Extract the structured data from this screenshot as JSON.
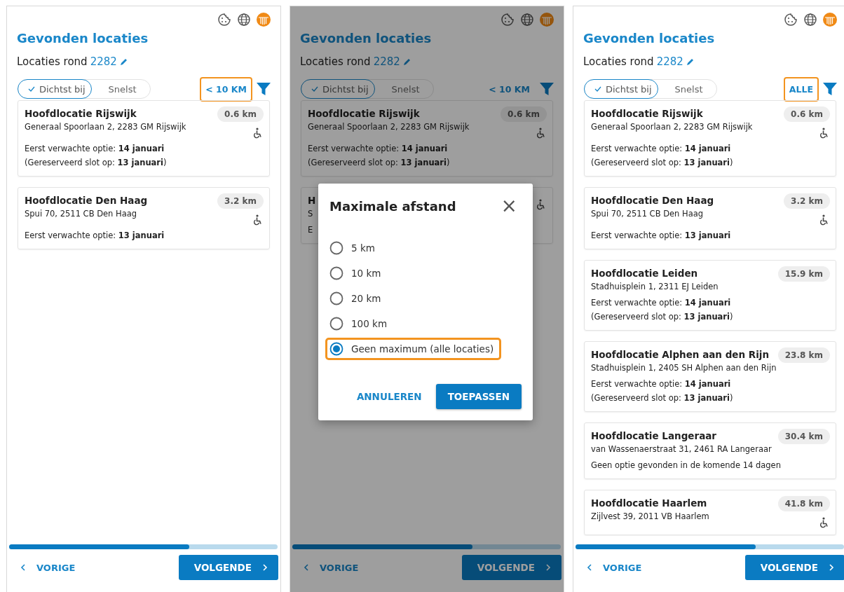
{
  "panels": [
    {
      "title": "Gevonden locaties",
      "search_area": {
        "label": "Locaties rond",
        "postcode": "2282"
      },
      "sort_options": [
        {
          "label": "Dichtst bij",
          "selected": true
        },
        {
          "label": "Snelst",
          "selected": false
        }
      ],
      "distance_filter": {
        "label": "< 10 KM",
        "highlighted": true
      },
      "locations": [
        {
          "name": "Hoofdlocatie Rijswijk",
          "address": "Generaal Spoorlaan 2, 2283 GM Rijswijk",
          "distance": "0.6 km",
          "accessible": true,
          "details": [
            "Eerst verwachte optie: **14 januari**",
            "(Gereserveerd slot op: **13 januari**)"
          ]
        },
        {
          "name": "Hoofdlocatie Den Haag",
          "address": "Spui 70, 2511 CB Den Haag",
          "distance": "3.2 km",
          "accessible": true,
          "details": [
            "Eerst verwachte optie: **13 januari**"
          ]
        }
      ],
      "progress": {
        "level": 0.67
      },
      "navigation": {
        "back": "VORIGE",
        "next": "VOLGENDE"
      }
    },
    {
      "title": "Gevonden locaties",
      "search_area": {
        "label": "Locaties rond",
        "postcode": "2282"
      },
      "sort_options": [
        {
          "label": "Dichtst bij",
          "selected": true
        },
        {
          "label": "Snelst",
          "selected": false
        }
      ],
      "distance_filter": {
        "label": "< 10 KM",
        "highlighted": false
      },
      "locations": [
        {
          "name": "Hoofdlocatie Rijswijk",
          "address": "Generaal Spoorlaan 2, 2283 GM Rijswijk",
          "distance": "0.6 km",
          "accessible": true,
          "details": [
            "Eerst verwachte optie: **14 januari**",
            "(Gereserveerd slot op: **13 januari**)"
          ]
        },
        {
          "name": "H",
          "address": "S",
          "accessible": true,
          "details": [
            "E"
          ]
        }
      ],
      "progress": {
        "level": 0.67
      },
      "navigation": {
        "back": "VORIGE",
        "next": "VOLGENDE"
      },
      "dialog": {
        "title": "Maximale afstand",
        "close": "×",
        "options": [
          {
            "label": "5 km",
            "selected": false,
            "highlighted": false
          },
          {
            "label": "10 km",
            "selected": false,
            "highlighted": false
          },
          {
            "label": "20 km",
            "selected": false,
            "highlighted": false
          },
          {
            "label": "100 km",
            "selected": false,
            "highlighted": false
          },
          {
            "label": "Geen maximum (alle locaties)",
            "selected": true,
            "highlighted": true
          }
        ],
        "cancel": "ANNULEREN",
        "apply": "TOEPASSEN"
      }
    },
    {
      "title": "Gevonden locaties",
      "search_area": {
        "label": "Locaties rond",
        "postcode": "2282"
      },
      "sort_options": [
        {
          "label": "Dichtst bij",
          "selected": true
        },
        {
          "label": "Snelst",
          "selected": false
        }
      ],
      "distance_filter": {
        "label": "ALLE",
        "highlighted": true
      },
      "locations": [
        {
          "name": "Hoofdlocatie Rijswijk",
          "address": "Generaal Spoorlaan 2, 2283 GM Rijswijk",
          "distance": "0.6 km",
          "accessible": true,
          "details": [
            "Eerst verwachte optie: **14 januari**",
            "(Gereserveerd slot op: **13 januari**)"
          ]
        },
        {
          "name": "Hoofdlocatie Den Haag",
          "address": "Spui 70, 2511 CB Den Haag",
          "distance": "3.2 km",
          "accessible": true,
          "details": [
            "Eerst verwachte optie: **13 januari**"
          ]
        },
        {
          "name": "Hoofdlocatie Leiden",
          "address": "Stadhuisplein 1, 2311 EJ Leiden",
          "distance": "15.9 km",
          "accessible": false,
          "details": [
            "Eerst verwachte optie: **14 januari**",
            "(Gereserveerd slot op: **13 januari**)"
          ]
        },
        {
          "name": "Hoofdlocatie Alphen aan den Rijn",
          "address": "Stadhuisplein 1, 2405 SH Alphen aan den Rijn",
          "distance": "23.8 km",
          "accessible": false,
          "details": [
            "Eerst verwachte optie: **14 januari**",
            "(Gereserveerd slot op: **13 januari**)"
          ]
        },
        {
          "name": "Hoofdlocatie Langeraar",
          "address": "van Wassenaerstraat 31, 2461 RA Langeraar",
          "distance": "30.4 km",
          "accessible": false,
          "details": [
            "Geen optie gevonden in de komende 14 dagen"
          ]
        },
        {
          "name": "Hoofdlocatie Haarlem",
          "address": "Zijlvest 39, 2011 VB Haarlem",
          "distance": "41.8 km",
          "accessible": true
        }
      ],
      "progress": {
        "level": 0.67
      },
      "navigation": {
        "back": "VORIGE",
        "next": "VOLGENDE"
      }
    }
  ]
}
